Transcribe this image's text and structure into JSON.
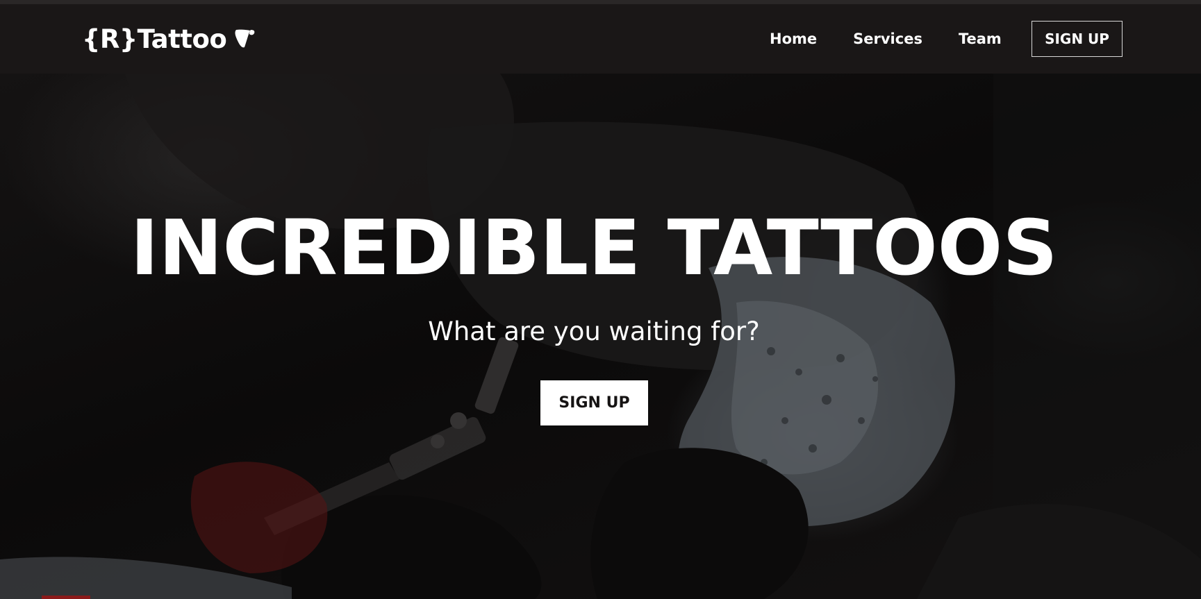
{
  "brand": {
    "name": "{R}Tattoo",
    "logo_icon": "typo3-logo-icon"
  },
  "nav": {
    "links": [
      {
        "label": "Home"
      },
      {
        "label": "Services"
      },
      {
        "label": "Team"
      }
    ],
    "signup_label": "SIGN UP"
  },
  "hero": {
    "title": "INCREDIBLE TATTOOS",
    "subtitle": "What are you waiting for?",
    "cta_label": "SIGN UP",
    "background_image": "tattoo-artist-working-photo"
  },
  "colors": {
    "navbar_bg": "#1a1717",
    "hero_bg": "#0f0d0d",
    "text": "#ffffff",
    "cta_bg": "#ffffff",
    "cta_text": "#151313"
  }
}
